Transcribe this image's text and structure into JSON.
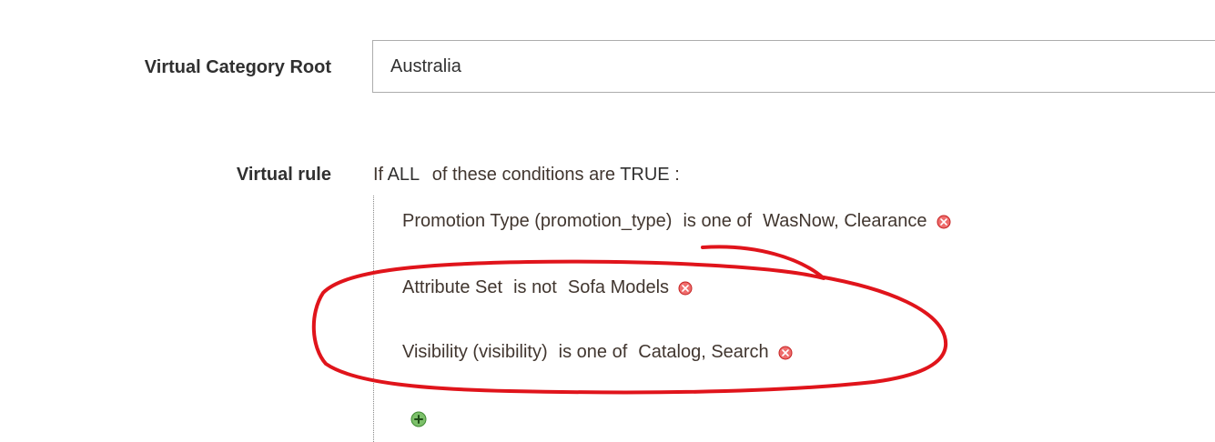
{
  "virtual_category_root": {
    "label": "Virtual Category Root",
    "value": "Australia"
  },
  "virtual_rule": {
    "label": "Virtual rule",
    "header": {
      "prefix": "If",
      "aggregator": "ALL",
      "middle": "of these conditions are",
      "value": "TRUE",
      "suffix": ":"
    },
    "conditions": [
      {
        "attribute": "Promotion Type (promotion_type)",
        "operator": "is one of",
        "value": "WasNow, Clearance"
      },
      {
        "attribute": "Attribute Set",
        "operator": "is not",
        "value": "Sofa Models"
      },
      {
        "attribute": "Visibility (visibility)",
        "operator": "is one of",
        "value": "Catalog, Search"
      }
    ]
  },
  "icons": {
    "remove": "remove-condition-icon",
    "add": "add-condition-icon"
  },
  "colors": {
    "remove_icon": "#e22626",
    "add_icon": "#5aa14a",
    "annotation": "#e0141b"
  }
}
